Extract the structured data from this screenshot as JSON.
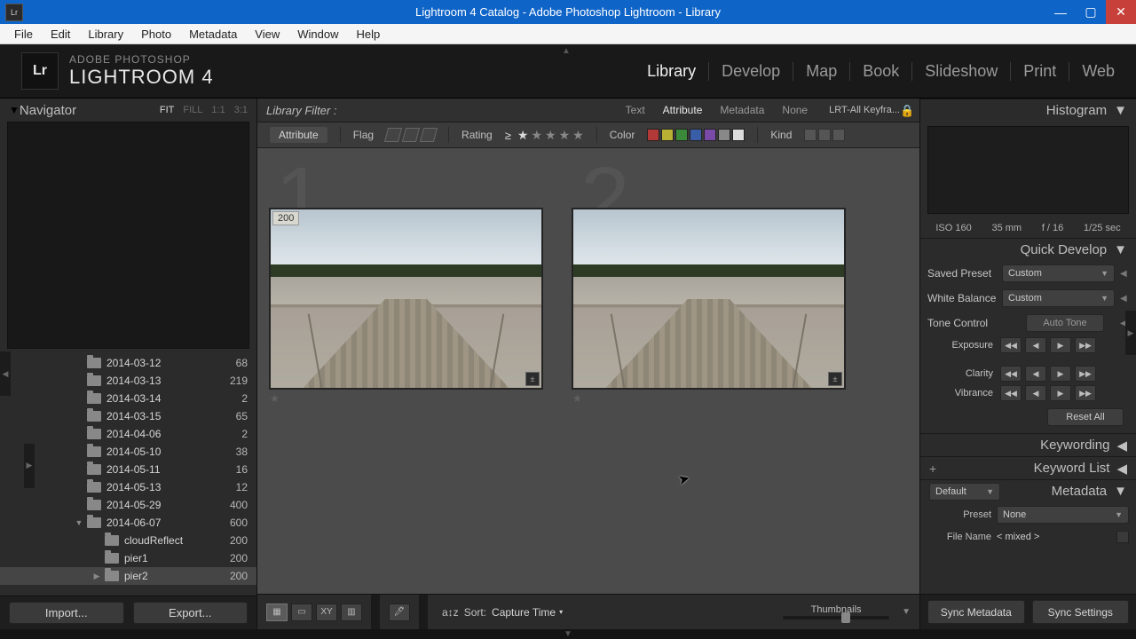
{
  "window": {
    "title": "Lightroom 4 Catalog - Adobe Photoshop Lightroom - Library"
  },
  "menu": [
    "File",
    "Edit",
    "Library",
    "Photo",
    "Metadata",
    "View",
    "Window",
    "Help"
  ],
  "brand": {
    "top": "ADOBE PHOTOSHOP",
    "bottom": "LIGHTROOM 4",
    "logo": "Lr"
  },
  "modules": [
    "Library",
    "Develop",
    "Map",
    "Book",
    "Slideshow",
    "Print",
    "Web"
  ],
  "active_module": "Library",
  "navigator": {
    "label": "Navigator",
    "zooms": [
      "FIT",
      "FILL",
      "1:1",
      "3:1"
    ],
    "active_zoom": "FIT"
  },
  "folders": [
    {
      "name": "2014-03-12",
      "count": 68,
      "depth": 0
    },
    {
      "name": "2014-03-13",
      "count": 219,
      "depth": 0
    },
    {
      "name": "2014-03-14",
      "count": 2,
      "depth": 0
    },
    {
      "name": "2014-03-15",
      "count": 65,
      "depth": 0
    },
    {
      "name": "2014-04-06",
      "count": 2,
      "depth": 0
    },
    {
      "name": "2014-05-10",
      "count": 38,
      "depth": 0
    },
    {
      "name": "2014-05-11",
      "count": 16,
      "depth": 0
    },
    {
      "name": "2014-05-13",
      "count": 12,
      "depth": 0
    },
    {
      "name": "2014-05-29",
      "count": 400,
      "depth": 0
    },
    {
      "name": "2014-06-07",
      "count": 600,
      "depth": 0,
      "expanded": true
    },
    {
      "name": "cloudReflect",
      "count": 200,
      "depth": 1
    },
    {
      "name": "pier1",
      "count": 200,
      "depth": 1
    },
    {
      "name": "pier2",
      "count": 200,
      "depth": 1,
      "selected": true,
      "hasChildren": true
    }
  ],
  "impexp": {
    "import": "Import...",
    "export": "Export..."
  },
  "filter": {
    "label": "Library Filter :",
    "tabs": [
      "Text",
      "Attribute",
      "Metadata",
      "None"
    ],
    "active_tab": "Attribute",
    "preset": "LRT-All Keyfra..."
  },
  "attr": {
    "tag": "Attribute",
    "flag": "Flag",
    "rating": "Rating",
    "star_value": 1,
    "op": "≥",
    "color": "Color",
    "swatches": [
      "#b33838",
      "#b8b034",
      "#3a8a3a",
      "#3a5da8",
      "#7a4aa8",
      "#888888",
      "#dcdcdc"
    ],
    "kind": "Kind"
  },
  "compare": {
    "left_num": "1",
    "right_num": "2",
    "index_badge": "200"
  },
  "camerainfo": {
    "iso": "ISO 160",
    "fl": "35 mm",
    "ap": "f / 16",
    "sh": "1/25 sec"
  },
  "rightpanels": {
    "histogram": "Histogram",
    "quickdev": "Quick Develop",
    "keywording": "Keywording",
    "keywordlist": "Keyword List",
    "metadata": "Metadata"
  },
  "quickdev": {
    "saved_preset_lbl": "Saved Preset",
    "saved_preset_val": "Custom",
    "wb_lbl": "White Balance",
    "wb_val": "Custom",
    "tone_lbl": "Tone Control",
    "auto_tone": "Auto Tone",
    "exposure": "Exposure",
    "clarity": "Clarity",
    "vibrance": "Vibrance",
    "reset": "Reset All"
  },
  "metadata": {
    "preset_dropdown": "Default",
    "preset_lbl": "Preset",
    "preset_val": "None",
    "filename_lbl": "File Name",
    "filename_val": "< mixed >"
  },
  "footer": {
    "sort_lbl": "Sort:",
    "sort_val": "Capture Time",
    "thumb_lbl": "Thumbnails"
  },
  "sync": {
    "meta": "Sync Metadata",
    "settings": "Sync Settings"
  }
}
